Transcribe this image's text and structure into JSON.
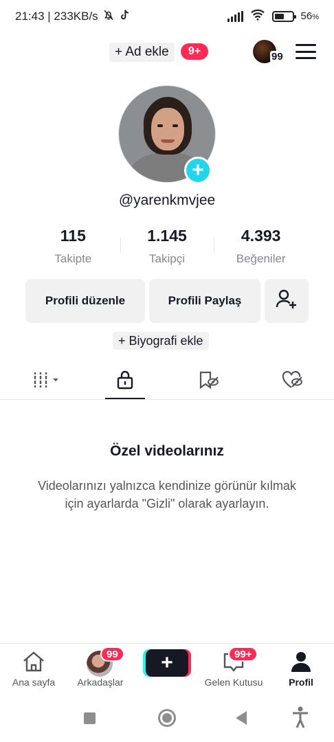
{
  "status_bar": {
    "time_speed": "21:43 | 233KB/s",
    "icons": [
      "bell-off-icon",
      "tiktok-icon",
      "signal-icon",
      "wifi-icon",
      "battery-icon"
    ],
    "battery_level": 0.56,
    "battery_percent": "56",
    "battery_percent_sign": "%"
  },
  "header": {
    "add_name_label": "+ Ad ekle",
    "notification_badge": "9+",
    "avatar_badge": "99",
    "menu_icon": "hamburger-menu-icon"
  },
  "profile": {
    "username": "@yarenkmvjee",
    "avatar_add_icon": "plus-icon",
    "stats": [
      {
        "value": "115",
        "label": "Takipte"
      },
      {
        "value": "1.145",
        "label": "Takipçi"
      },
      {
        "value": "4.393",
        "label": "Beğeniler"
      }
    ],
    "edit_button": "Profili düzenle",
    "share_button": "Profili Paylaş",
    "add_friend_icon": "add-user-icon",
    "bio_add": "+ Biyografi ekle"
  },
  "tabs": [
    {
      "icon": "grid-icon",
      "active": false
    },
    {
      "icon": "lock-icon",
      "active": true
    },
    {
      "icon": "bookmark-hidden-icon",
      "active": false
    },
    {
      "icon": "heart-hidden-icon",
      "active": false
    }
  ],
  "empty_state": {
    "title": "Özel videolarınız",
    "description": "Videolarınızı yalnızca kendinize görünür kılmak için ayarlarda \"Gizli\" olarak ayarlayın."
  },
  "bottom_nav": {
    "home": "Ana sayfa",
    "friends": "Arkadaşlar",
    "friends_badge": "99",
    "create_icon": "plus-icon",
    "inbox": "Gelen Kutusu",
    "inbox_badge": "99+",
    "profile": "Profil"
  },
  "colors": {
    "accent": "#fe2c55",
    "teal": "#20d5ec",
    "text": "#161823",
    "muted": "#86878b",
    "button_bg": "#f1f1f2"
  }
}
